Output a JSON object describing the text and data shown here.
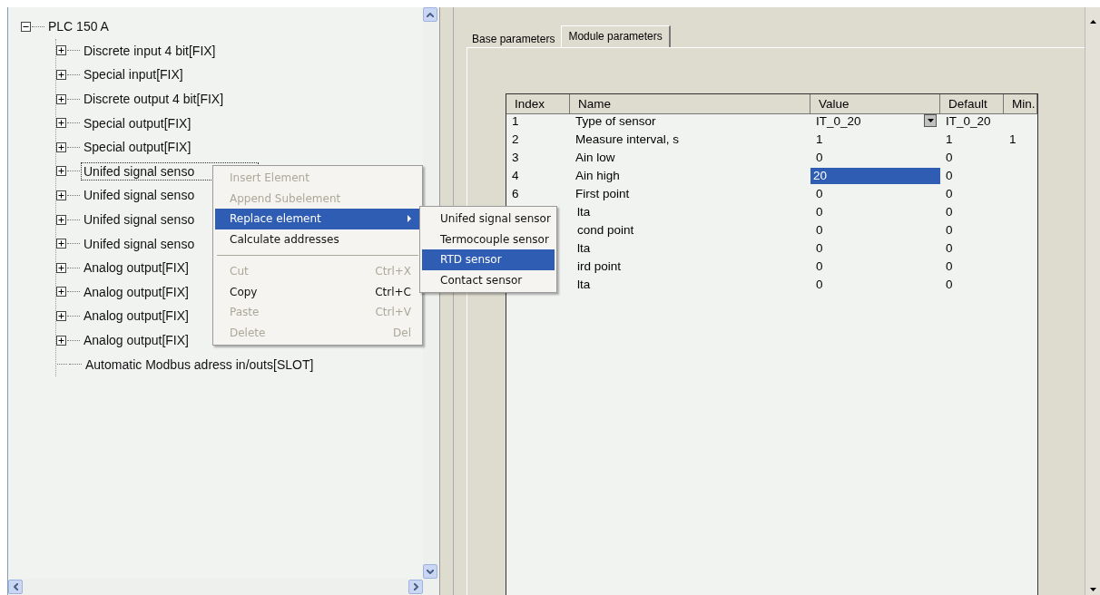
{
  "tree": {
    "label": "PLC 150 A",
    "kind": "expanded",
    "selected": false,
    "children": [
      {
        "label": "Discrete input 4 bit[FIX]",
        "kind": "collapsed",
        "selected": false
      },
      {
        "label": "Special input[FIX]",
        "kind": "collapsed",
        "selected": false
      },
      {
        "label": "Discrete output 4 bit[FIX]",
        "kind": "collapsed",
        "selected": false
      },
      {
        "label": "Special output[FIX]",
        "kind": "collapsed",
        "selected": false
      },
      {
        "label": "Special output[FIX]",
        "kind": "collapsed",
        "selected": false
      },
      {
        "label": "Unifed signal senso",
        "kind": "collapsed",
        "selected": true
      },
      {
        "label": "Unifed signal senso",
        "kind": "collapsed",
        "selected": false
      },
      {
        "label": "Unifed signal senso",
        "kind": "collapsed",
        "selected": false
      },
      {
        "label": "Unifed signal senso",
        "kind": "collapsed",
        "selected": false
      },
      {
        "label": "Analog output[FIX]",
        "kind": "collapsed",
        "selected": false
      },
      {
        "label": "Analog output[FIX]",
        "kind": "collapsed",
        "selected": false
      },
      {
        "label": "Analog output[FIX]",
        "kind": "collapsed",
        "selected": false
      },
      {
        "label": "Analog output[FIX]",
        "kind": "collapsed",
        "selected": false
      },
      {
        "label": "Automatic Modbus adress in/outs[SLOT]",
        "kind": "leaf",
        "selected": false
      }
    ]
  },
  "context_menu": {
    "items": [
      {
        "kind": "item",
        "label": "Insert Element",
        "disabled": true,
        "selected": false,
        "submenu": false
      },
      {
        "kind": "item",
        "label": "Append Subelement",
        "disabled": true,
        "selected": false,
        "submenu": false
      },
      {
        "kind": "item",
        "label": "Replace element",
        "disabled": false,
        "selected": true,
        "submenu": true
      },
      {
        "kind": "item",
        "label": "Calculate addresses",
        "disabled": false,
        "selected": false,
        "submenu": false
      },
      {
        "kind": "separator"
      },
      {
        "kind": "item",
        "label": "Cut",
        "shortcut": "Ctrl+X",
        "disabled": true,
        "selected": false,
        "submenu": false
      },
      {
        "kind": "item",
        "label": "Copy",
        "shortcut": "Ctrl+C",
        "disabled": false,
        "selected": false,
        "submenu": false
      },
      {
        "kind": "item",
        "label": "Paste",
        "shortcut": "Ctrl+V",
        "disabled": true,
        "selected": false,
        "submenu": false
      },
      {
        "kind": "item",
        "label": "Delete",
        "shortcut": "Del",
        "disabled": true,
        "selected": false,
        "submenu": false
      }
    ]
  },
  "submenu": {
    "items": [
      {
        "label": "Unifed signal sensor",
        "selected": false
      },
      {
        "label": "Termocouple sensor",
        "selected": false
      },
      {
        "label": "RTD sensor",
        "selected": true
      },
      {
        "label": "Contact sensor",
        "selected": false
      }
    ]
  },
  "tabs": [
    {
      "label": "Base parameters",
      "selected": false
    },
    {
      "label": "Module parameters",
      "selected": true
    }
  ],
  "table": {
    "columns": [
      "Index",
      "Name",
      "Value",
      "Default",
      "Min."
    ],
    "rows": [
      {
        "index": "1",
        "name": "Type of sensor",
        "value": "IT_0_20",
        "default": "IT_0_20",
        "min": "",
        "kind": "dropdown",
        "selected": false
      },
      {
        "index": "2",
        "name": "Measure interval, s",
        "value": "1",
        "default": "1",
        "min": "1",
        "kind": "text",
        "selected": false
      },
      {
        "index": "3",
        "name": "Ain low",
        "value": "0",
        "default": "0",
        "min": "",
        "kind": "text",
        "selected": false
      },
      {
        "index": "4",
        "name": "Ain high",
        "value": "20",
        "default": "0",
        "min": "",
        "kind": "text",
        "selected": true
      },
      {
        "index": "6",
        "name": "First point",
        "value": "0",
        "default": "0",
        "min": "",
        "kind": "text",
        "selected": false
      },
      {
        "index": "",
        "name": "lta",
        "value": "0",
        "default": "0",
        "min": "",
        "kind": "text",
        "selected": false
      },
      {
        "index": "",
        "name": "cond point",
        "value": "0",
        "default": "0",
        "min": "",
        "kind": "text",
        "selected": false
      },
      {
        "index": "",
        "name": "lta",
        "value": "0",
        "default": "0",
        "min": "",
        "kind": "text",
        "selected": false
      },
      {
        "index": "",
        "name": "ird point",
        "value": "0",
        "default": "0",
        "min": "",
        "kind": "text",
        "selected": false
      },
      {
        "index": "",
        "name": "lta",
        "value": "0",
        "default": "0",
        "min": "",
        "kind": "text",
        "selected": false
      }
    ]
  }
}
